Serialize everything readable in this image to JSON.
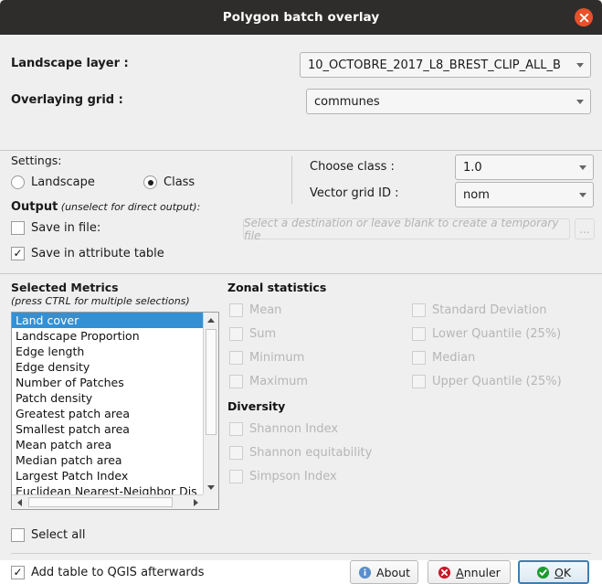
{
  "window": {
    "title": "Polygon batch overlay",
    "close_icon": "close-icon",
    "titlebar_bg": "#2e2d2b",
    "close_bg": "#e8512a"
  },
  "form": {
    "landscape_layer_label": "Landscape layer :",
    "landscape_layer_value": "10_OCTOBRE_2017_L8_BREST_CLIP_ALL_B",
    "overlaying_grid_label": "Overlaying grid :",
    "overlaying_grid_value": "communes"
  },
  "settings": {
    "label": "Settings:",
    "radios": [
      {
        "label": "Landscape",
        "checked": false
      },
      {
        "label": "Class",
        "checked": true
      }
    ],
    "choose_class_label": "Choose class :",
    "choose_class_value": "1.0",
    "vector_grid_id_label": "Vector grid ID :",
    "vector_grid_id_value": "nom"
  },
  "output": {
    "title": "Output",
    "hint": " (unselect for direct output):",
    "save_in_file_label": "Save in file:",
    "save_in_file_checked": false,
    "save_in_attribute_label": "Save in attribute table",
    "save_in_attribute_checked": true,
    "file_placeholder": "Select a destination or leave blank to create a temporary file",
    "browse_label": "..."
  },
  "metrics": {
    "title": "Selected Metrics",
    "subtitle": "(press CTRL for multiple selections)",
    "selected_index": 0,
    "selection_color": "#3390d4",
    "items": [
      "Land cover",
      "Landscape Proportion",
      "Edge length",
      "Edge density",
      "Number of Patches",
      "Patch density",
      "Greatest patch area",
      "Smallest patch area",
      "Mean patch area",
      "Median patch area",
      "Largest Patch Index",
      "Euclidean Nearest-Neighbor Dis"
    ]
  },
  "zonal_statistics": {
    "title": "Zonal statistics",
    "left_column": [
      {
        "label": "Mean",
        "checked": false,
        "disabled": true
      },
      {
        "label": "Sum",
        "checked": false,
        "disabled": true
      },
      {
        "label": "Minimum",
        "checked": false,
        "disabled": true
      },
      {
        "label": "Maximum",
        "checked": false,
        "disabled": true
      }
    ],
    "right_column": [
      {
        "label": "Standard Deviation",
        "checked": false,
        "disabled": true
      },
      {
        "label": "Lower Quantile (25%)",
        "checked": false,
        "disabled": true
      },
      {
        "label": "Median",
        "checked": false,
        "disabled": true
      },
      {
        "label": "Upper Quantile (25%)",
        "checked": false,
        "disabled": true
      }
    ]
  },
  "diversity": {
    "title": "Diversity",
    "items": [
      {
        "label": "Shannon Index",
        "checked": false,
        "disabled": true
      },
      {
        "label": "Shannon equitability",
        "checked": false,
        "disabled": true
      },
      {
        "label": "Simpson Index",
        "checked": false,
        "disabled": true
      }
    ]
  },
  "footer": {
    "select_all_label": "Select all",
    "select_all_checked": false,
    "add_table_label": "Add table to QGIS afterwards",
    "add_table_checked": true,
    "buttons": [
      {
        "name": "about",
        "label": "About",
        "icon": "info-icon",
        "icon_color": "#5b8fc9"
      },
      {
        "name": "cancel",
        "label": "Annuler",
        "icon": "cancel-icon",
        "icon_color": "#c9182b",
        "accel_index": 0
      },
      {
        "name": "ok",
        "label": "OK",
        "icon": "check-icon",
        "icon_color": "#1c9c2e",
        "accel_index": 0,
        "default": true
      }
    ]
  }
}
